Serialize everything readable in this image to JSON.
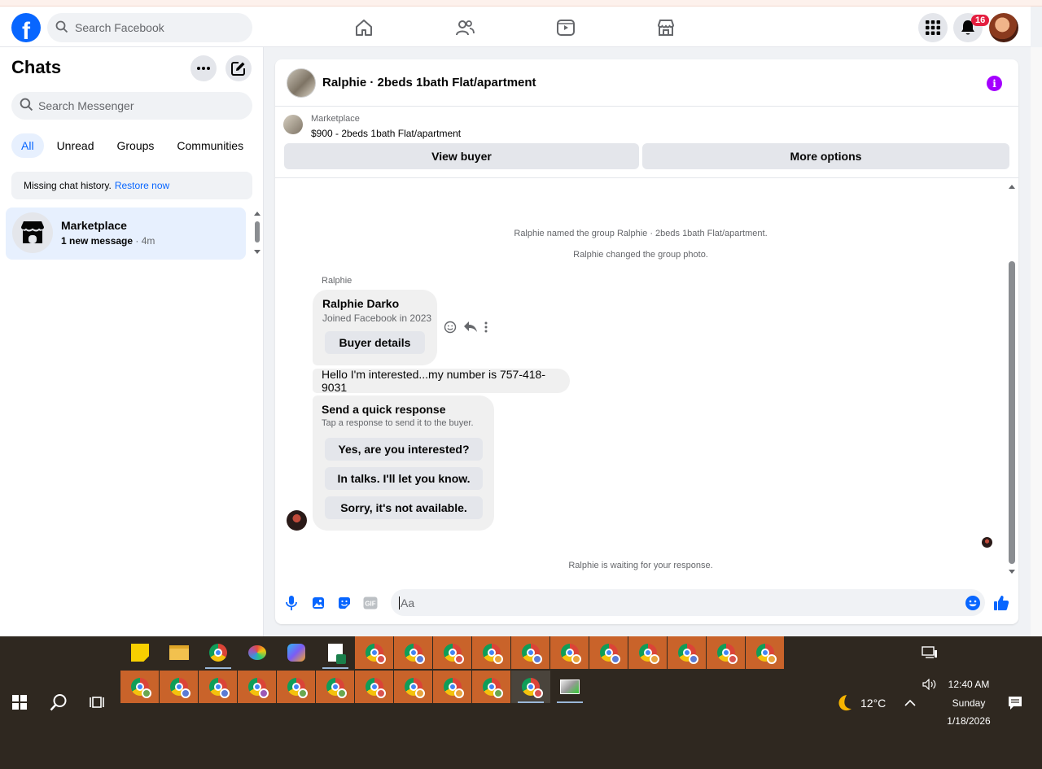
{
  "topbar": {
    "logo": "f",
    "search_placeholder": "Search Facebook",
    "nav_icons": [
      "home-icon",
      "friends-icon",
      "watch-icon",
      "marketplace-icon"
    ],
    "notification_count": "16"
  },
  "sidebar": {
    "title": "Chats",
    "search_placeholder": "Search Messenger",
    "filters": [
      "All",
      "Unread",
      "Groups",
      "Communities"
    ],
    "missing_history": "Missing chat history.",
    "restore_link": "Restore now",
    "chat": {
      "name": "Marketplace",
      "preview": "1 new message",
      "time": "4m"
    }
  },
  "conversation": {
    "title": "Ralphie · 2beds 1bath Flat/apartment",
    "marketplace_label": "Marketplace",
    "listing": "$900 - 2beds 1bath Flat/apartment",
    "view_buyer": "View buyer",
    "more_options": "More options",
    "system_1": "Ralphie named the group Ralphie · 2beds 1bath Flat/apartment.",
    "system_2": "Ralphie changed the group photo.",
    "sender": "Ralphie",
    "buyer_name": "Ralphie Darko",
    "buyer_joined": "Joined Facebook in 2023",
    "buyer_details": "Buyer details",
    "message": "Hello I'm interested...my number is 757-418-9031",
    "quick_title": "Send a quick response",
    "quick_sub": "Tap a response to send it to the buyer.",
    "quick_replies": [
      "Yes, are you interested?",
      "In talks. I'll let you know.",
      "Sorry, it's not available."
    ],
    "waiting": "Ralphie is waiting for your response.",
    "composer_placeholder": "Aa"
  },
  "taskbar": {
    "weather": "12°C",
    "time": "12:40 AM",
    "day": "Sunday",
    "date": "1/18/2026"
  },
  "colors": {
    "brand": "#0866ff",
    "badge": "#e41e3f",
    "info": "#a400ff",
    "taskbar_bg": "#2f2820",
    "taskbar_app": "#c9632a"
  }
}
